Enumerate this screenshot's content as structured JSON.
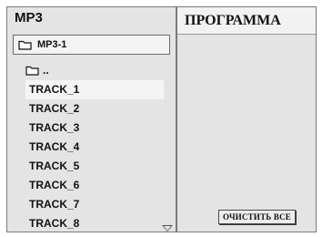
{
  "browser": {
    "title": "MP3",
    "current_folder": {
      "icon": "folder-icon",
      "label": "MP3-1"
    },
    "parent_folder": {
      "icon": "folder-icon",
      "label": ".."
    },
    "tracks": [
      {
        "label": "TRACK_1",
        "selected": true
      },
      {
        "label": "TRACK_2",
        "selected": false
      },
      {
        "label": "TRACK_3",
        "selected": false
      },
      {
        "label": "TRACK_4",
        "selected": false
      },
      {
        "label": "TRACK_5",
        "selected": false
      },
      {
        "label": "TRACK_6",
        "selected": false
      },
      {
        "label": "TRACK_7",
        "selected": false
      },
      {
        "label": "TRACK_8",
        "selected": false
      }
    ],
    "scroll_icon": "chevron-down-icon"
  },
  "program": {
    "title": "ПРОГРАММА",
    "clear_all_label": "ОЧИСТИТЬ ВСЕ"
  },
  "colors": {
    "panel_bg": "#e4e4e4",
    "header_bg": "#f2f2f2",
    "selected_bg": "#f4f4f4",
    "border": "#7a7a7a",
    "text": "#111111"
  }
}
